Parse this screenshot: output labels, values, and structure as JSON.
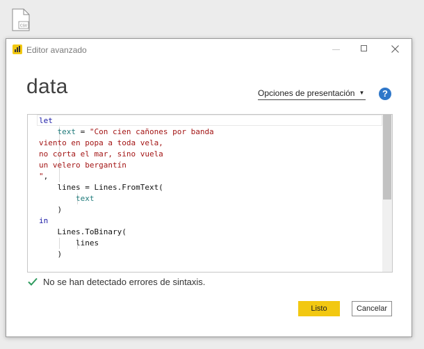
{
  "desktop": {
    "file_icon_label": "CSV"
  },
  "dialog": {
    "window_title": "Editor avanzado",
    "query_name": "data",
    "display_options_label": "Opciones de presentación",
    "help_symbol": "?",
    "status_message": "No se han detectado errores de sintaxis.",
    "done_label": "Listo",
    "cancel_label": "Cancelar"
  },
  "code": {
    "lines": [
      [
        {
          "text": "let",
          "type": "keyword"
        }
      ],
      [
        {
          "text": "    ",
          "type": "plain"
        },
        {
          "text": "text",
          "type": "identifier"
        },
        {
          "text": " = ",
          "type": "plain"
        },
        {
          "text": "\"Con cien cañones por banda",
          "type": "string"
        }
      ],
      [
        {
          "text": "viento en popa a toda vela,",
          "type": "string"
        }
      ],
      [
        {
          "text": "no corta el mar, sino vuela",
          "type": "string"
        }
      ],
      [
        {
          "text": "un velero bergantín",
          "type": "string"
        }
      ],
      [
        {
          "text": "\"",
          "type": "string"
        },
        {
          "text": ",",
          "type": "plain"
        }
      ],
      [
        {
          "text": "    lines = Lines.FromText(",
          "type": "plain"
        }
      ],
      [
        {
          "text": "        ",
          "type": "plain"
        },
        {
          "text": "text",
          "type": "identifier"
        }
      ],
      [
        {
          "text": "    )",
          "type": "plain"
        }
      ],
      [
        {
          "text": "in",
          "type": "keyword"
        }
      ],
      [
        {
          "text": "    Lines.ToBinary(",
          "type": "plain"
        }
      ],
      [
        {
          "text": "        lines",
          "type": "plain"
        }
      ],
      [
        {
          "text": "    )",
          "type": "plain"
        }
      ]
    ]
  },
  "colors": {
    "accent_yellow": "#f2c811",
    "keyword": "#1a1aa6",
    "identifier": "#1e7a7a",
    "string": "#a31515",
    "success_check": "#2e9a5e",
    "help_blue": "#2f77c9"
  },
  "icons": {
    "file": "csv-file-icon",
    "app": "power-bi-icon",
    "minimize": "minimize-icon",
    "maximize": "maximize-icon",
    "close": "close-icon",
    "dropdown": "chevron-down-icon",
    "help": "help-icon",
    "status": "checkmark-icon"
  }
}
